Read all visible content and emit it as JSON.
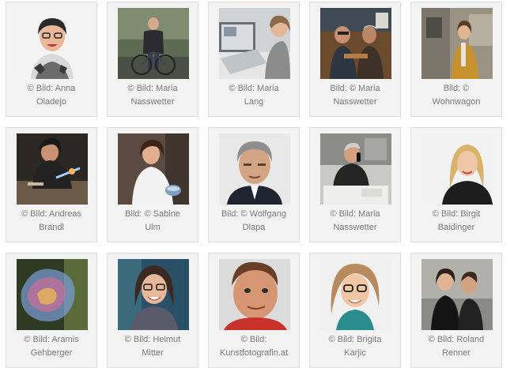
{
  "gallery": {
    "items": [
      {
        "caption1": "© Bild: Anna",
        "caption2": "Oladejo",
        "photo": "portrait-woman-smiling-glasses"
      },
      {
        "caption1": "© Bild: Maria",
        "caption2": "Nasswetter",
        "photo": "man-on-bicycle"
      },
      {
        "caption1": "© Bild: Maria",
        "caption2": "Lang",
        "photo": "woman-at-computer"
      },
      {
        "caption1": "Bild: © Maria",
        "caption2": "Nasswetter",
        "photo": "two-men-workshop"
      },
      {
        "caption1": "Bild: ©",
        "caption2": "Wohnwagon",
        "photo": "woman-by-house"
      },
      {
        "caption1": "© Bild: Andreas",
        "caption2": "Brandl",
        "photo": "woman-glassblowing"
      },
      {
        "caption1": "Bild: © Sabine",
        "caption2": "Ulm",
        "photo": "woman-with-bowl"
      },
      {
        "caption1": "Bild: © Wolfgang",
        "caption2": "Dlapa",
        "photo": "man-portrait-grey-hair"
      },
      {
        "caption1": "© Bild: Maria",
        "caption2": "Nasswetter",
        "photo": "man-on-phone-desk"
      },
      {
        "caption1": "© Bild: Birgit",
        "caption2": "Baidinger",
        "photo": "blonde-woman-smiling"
      },
      {
        "caption1": "© Bild: Aramis",
        "caption2": "Gehberger",
        "photo": "soap-bubble-forest"
      },
      {
        "caption1": "© Bild: Helmut",
        "caption2": "Mitter",
        "photo": "woman-glasses-laughing"
      },
      {
        "caption1": "© Bild:",
        "caption2": "Kunstfotografin.at",
        "photo": "man-closeup-red-shirt"
      },
      {
        "caption1": "© Bild: Brigita",
        "caption2": "Karjic",
        "photo": "woman-glasses-portrait"
      },
      {
        "caption1": "© Bild: Roland",
        "caption2": "Renner",
        "photo": "couple-portrait"
      }
    ]
  }
}
